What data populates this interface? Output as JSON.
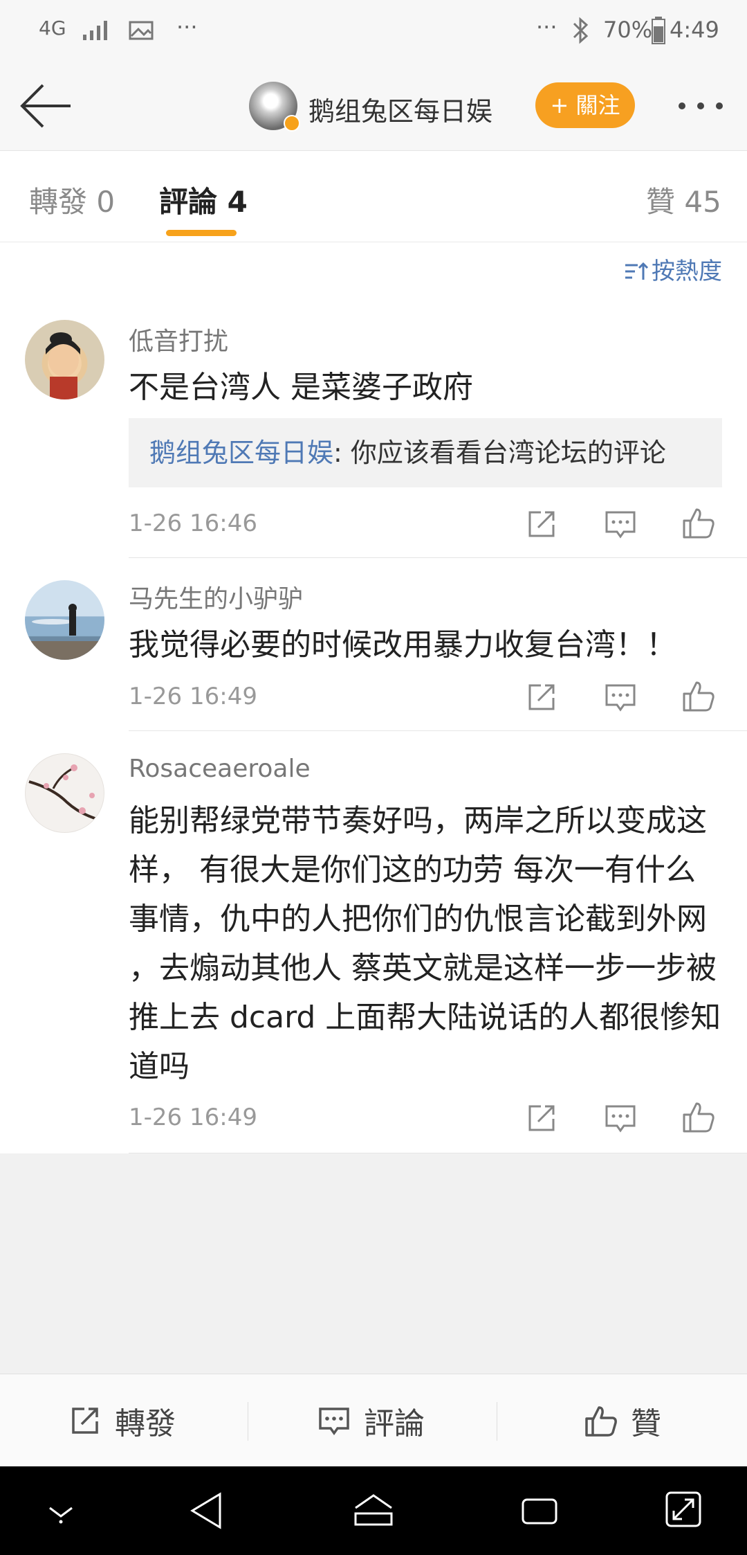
{
  "status_bar": {
    "network": "4G",
    "battery": "70%",
    "time": "4:49",
    "overflow": "···"
  },
  "nav": {
    "title": "鹅组兔区每日娱",
    "follow_label": "+ 關注"
  },
  "tabs": {
    "repost": "轉發 0",
    "comments": "評論 4",
    "likes": "贊 45"
  },
  "sort": {
    "label": "按熱度"
  },
  "comments": [
    {
      "username": "低音打扰",
      "text": "不是台湾人 是菜婆子政府",
      "reply_name": "鹅组兔区每日娱",
      "reply_text": ": 你应该看看台湾论坛的评论",
      "time": "1-26 16:46"
    },
    {
      "username": "马先生的小驴驴",
      "text": "我觉得必要的时候改用暴力收复台湾！！",
      "time": "1-26 16:49"
    },
    {
      "username": "Rosaceaeroale",
      "text": "能别帮绿党带节奏好吗，两岸之所以变成这样， 有很大是你们这的功劳 每次一有什么事情，仇中的人把你们的仇恨言论截到外网 ，去煽动其他人 蔡英文就是这样一步一步被推上去 dcard 上面帮大陆说话的人都很惨知道吗",
      "time": "1-26 16:49"
    }
  ],
  "bottom_bar": {
    "repost": "轉發",
    "comment": "評論",
    "like": "贊"
  },
  "colors": {
    "accent": "#f7a21b",
    "link": "#4f79b5"
  }
}
